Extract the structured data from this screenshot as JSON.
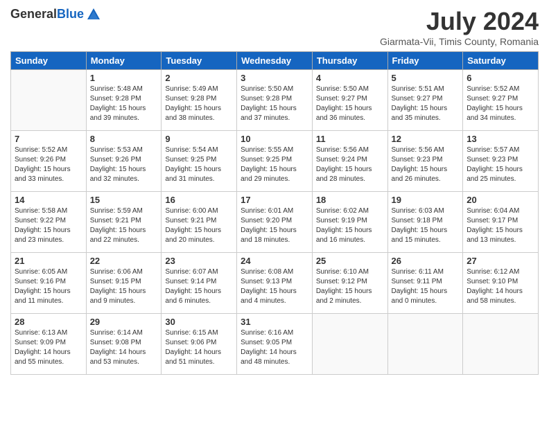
{
  "header": {
    "logo_general": "General",
    "logo_blue": "Blue",
    "main_title": "July 2024",
    "subtitle": "Giarmata-Vii, Timis County, Romania"
  },
  "calendar": {
    "headers": [
      "Sunday",
      "Monday",
      "Tuesday",
      "Wednesday",
      "Thursday",
      "Friday",
      "Saturday"
    ],
    "weeks": [
      [
        {
          "day": "",
          "info": ""
        },
        {
          "day": "1",
          "info": "Sunrise: 5:48 AM\nSunset: 9:28 PM\nDaylight: 15 hours\nand 39 minutes."
        },
        {
          "day": "2",
          "info": "Sunrise: 5:49 AM\nSunset: 9:28 PM\nDaylight: 15 hours\nand 38 minutes."
        },
        {
          "day": "3",
          "info": "Sunrise: 5:50 AM\nSunset: 9:28 PM\nDaylight: 15 hours\nand 37 minutes."
        },
        {
          "day": "4",
          "info": "Sunrise: 5:50 AM\nSunset: 9:27 PM\nDaylight: 15 hours\nand 36 minutes."
        },
        {
          "day": "5",
          "info": "Sunrise: 5:51 AM\nSunset: 9:27 PM\nDaylight: 15 hours\nand 35 minutes."
        },
        {
          "day": "6",
          "info": "Sunrise: 5:52 AM\nSunset: 9:27 PM\nDaylight: 15 hours\nand 34 minutes."
        }
      ],
      [
        {
          "day": "7",
          "info": "Sunrise: 5:52 AM\nSunset: 9:26 PM\nDaylight: 15 hours\nand 33 minutes."
        },
        {
          "day": "8",
          "info": "Sunrise: 5:53 AM\nSunset: 9:26 PM\nDaylight: 15 hours\nand 32 minutes."
        },
        {
          "day": "9",
          "info": "Sunrise: 5:54 AM\nSunset: 9:25 PM\nDaylight: 15 hours\nand 31 minutes."
        },
        {
          "day": "10",
          "info": "Sunrise: 5:55 AM\nSunset: 9:25 PM\nDaylight: 15 hours\nand 29 minutes."
        },
        {
          "day": "11",
          "info": "Sunrise: 5:56 AM\nSunset: 9:24 PM\nDaylight: 15 hours\nand 28 minutes."
        },
        {
          "day": "12",
          "info": "Sunrise: 5:56 AM\nSunset: 9:23 PM\nDaylight: 15 hours\nand 26 minutes."
        },
        {
          "day": "13",
          "info": "Sunrise: 5:57 AM\nSunset: 9:23 PM\nDaylight: 15 hours\nand 25 minutes."
        }
      ],
      [
        {
          "day": "14",
          "info": "Sunrise: 5:58 AM\nSunset: 9:22 PM\nDaylight: 15 hours\nand 23 minutes."
        },
        {
          "day": "15",
          "info": "Sunrise: 5:59 AM\nSunset: 9:21 PM\nDaylight: 15 hours\nand 22 minutes."
        },
        {
          "day": "16",
          "info": "Sunrise: 6:00 AM\nSunset: 9:21 PM\nDaylight: 15 hours\nand 20 minutes."
        },
        {
          "day": "17",
          "info": "Sunrise: 6:01 AM\nSunset: 9:20 PM\nDaylight: 15 hours\nand 18 minutes."
        },
        {
          "day": "18",
          "info": "Sunrise: 6:02 AM\nSunset: 9:19 PM\nDaylight: 15 hours\nand 16 minutes."
        },
        {
          "day": "19",
          "info": "Sunrise: 6:03 AM\nSunset: 9:18 PM\nDaylight: 15 hours\nand 15 minutes."
        },
        {
          "day": "20",
          "info": "Sunrise: 6:04 AM\nSunset: 9:17 PM\nDaylight: 15 hours\nand 13 minutes."
        }
      ],
      [
        {
          "day": "21",
          "info": "Sunrise: 6:05 AM\nSunset: 9:16 PM\nDaylight: 15 hours\nand 11 minutes."
        },
        {
          "day": "22",
          "info": "Sunrise: 6:06 AM\nSunset: 9:15 PM\nDaylight: 15 hours\nand 9 minutes."
        },
        {
          "day": "23",
          "info": "Sunrise: 6:07 AM\nSunset: 9:14 PM\nDaylight: 15 hours\nand 6 minutes."
        },
        {
          "day": "24",
          "info": "Sunrise: 6:08 AM\nSunset: 9:13 PM\nDaylight: 15 hours\nand 4 minutes."
        },
        {
          "day": "25",
          "info": "Sunrise: 6:10 AM\nSunset: 9:12 PM\nDaylight: 15 hours\nand 2 minutes."
        },
        {
          "day": "26",
          "info": "Sunrise: 6:11 AM\nSunset: 9:11 PM\nDaylight: 15 hours\nand 0 minutes."
        },
        {
          "day": "27",
          "info": "Sunrise: 6:12 AM\nSunset: 9:10 PM\nDaylight: 14 hours\nand 58 minutes."
        }
      ],
      [
        {
          "day": "28",
          "info": "Sunrise: 6:13 AM\nSunset: 9:09 PM\nDaylight: 14 hours\nand 55 minutes."
        },
        {
          "day": "29",
          "info": "Sunrise: 6:14 AM\nSunset: 9:08 PM\nDaylight: 14 hours\nand 53 minutes."
        },
        {
          "day": "30",
          "info": "Sunrise: 6:15 AM\nSunset: 9:06 PM\nDaylight: 14 hours\nand 51 minutes."
        },
        {
          "day": "31",
          "info": "Sunrise: 6:16 AM\nSunset: 9:05 PM\nDaylight: 14 hours\nand 48 minutes."
        },
        {
          "day": "",
          "info": ""
        },
        {
          "day": "",
          "info": ""
        },
        {
          "day": "",
          "info": ""
        }
      ]
    ]
  }
}
